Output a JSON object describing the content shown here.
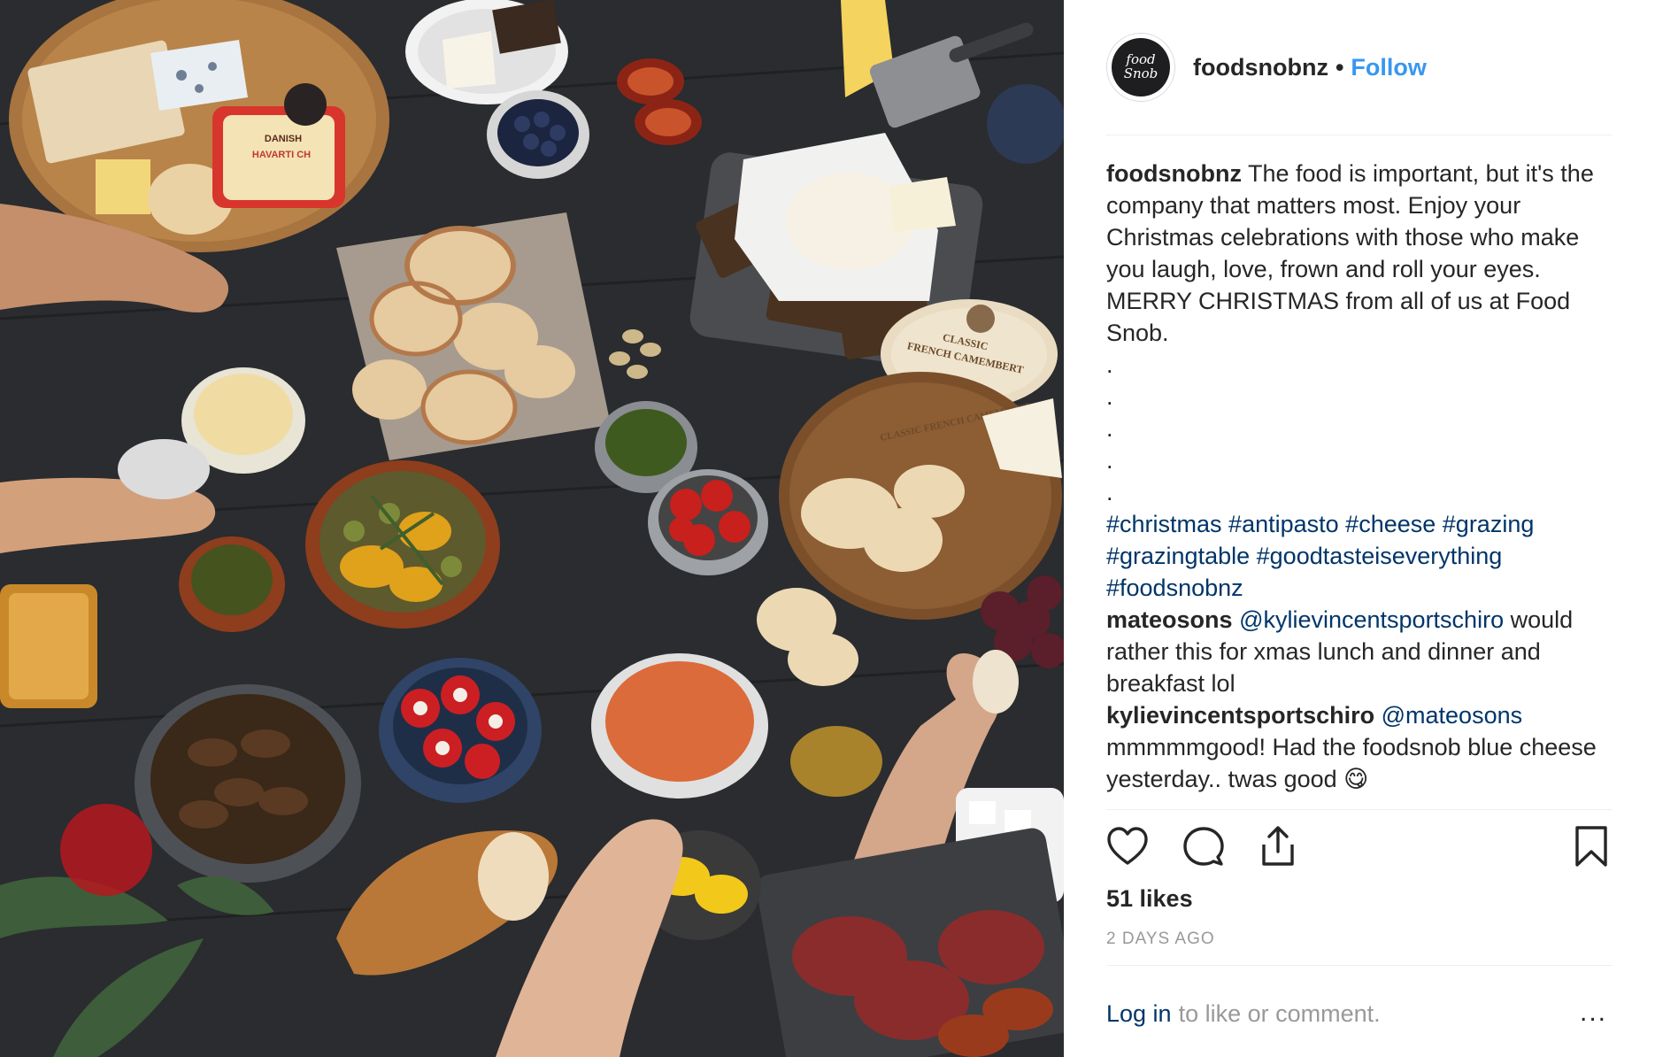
{
  "post": {
    "author": "foodsnobnz",
    "follow_label": "Follow",
    "separator": "•",
    "caption": {
      "username": "foodsnobnz",
      "text": "The food is important, but it's the company that matters most. Enjoy your Christmas celebrations with those who make you laugh, love, frown and roll your eyes. MERRY CHRISTMAS from all of us at Food Snob.",
      "dots": [
        ".",
        ".",
        ".",
        ".",
        "."
      ],
      "hashtags": [
        "#christmas",
        "#antipasto",
        "#cheese",
        "#grazing",
        "#grazingtable",
        "#goodtasteiseverything",
        "#foodsnobnz"
      ]
    },
    "comments": [
      {
        "username": "mateosons",
        "mention": "@kylievincentsportschiro",
        "text": "would rather this for xmas lunch and dinner and breakfast lol"
      },
      {
        "username": "kylievincentsportschiro",
        "mention": "@mateosons",
        "text": "mmmmmgood! Had the foodsnob blue cheese yesterday.. twas good 😋"
      }
    ],
    "likes": "51 likes",
    "timestamp": "2 DAYS AGO",
    "footer": {
      "login": "Log in",
      "rest": "to like or comment.",
      "more": "..."
    }
  },
  "icons": {
    "like": "heart-icon",
    "comment": "comment-bubble-icon",
    "share": "share-icon",
    "save": "bookmark-icon",
    "avatar": "food-snob-logo"
  },
  "logo_text": {
    "line1": "food",
    "line2": "Snob"
  },
  "photo_labels": {
    "danish": "DANISH",
    "havarti": "HAVARTI CH",
    "camembert_1": "CLASSIC",
    "camembert_2": "FRENCH CAMEMBERT",
    "camembert_rim": "CLASSIC FRENCH CAMEMBERT"
  },
  "colors": {
    "follow": "#3897f0",
    "hashtag": "#003569",
    "muted": "#999999",
    "text": "#262626",
    "divider": "#efefef"
  }
}
